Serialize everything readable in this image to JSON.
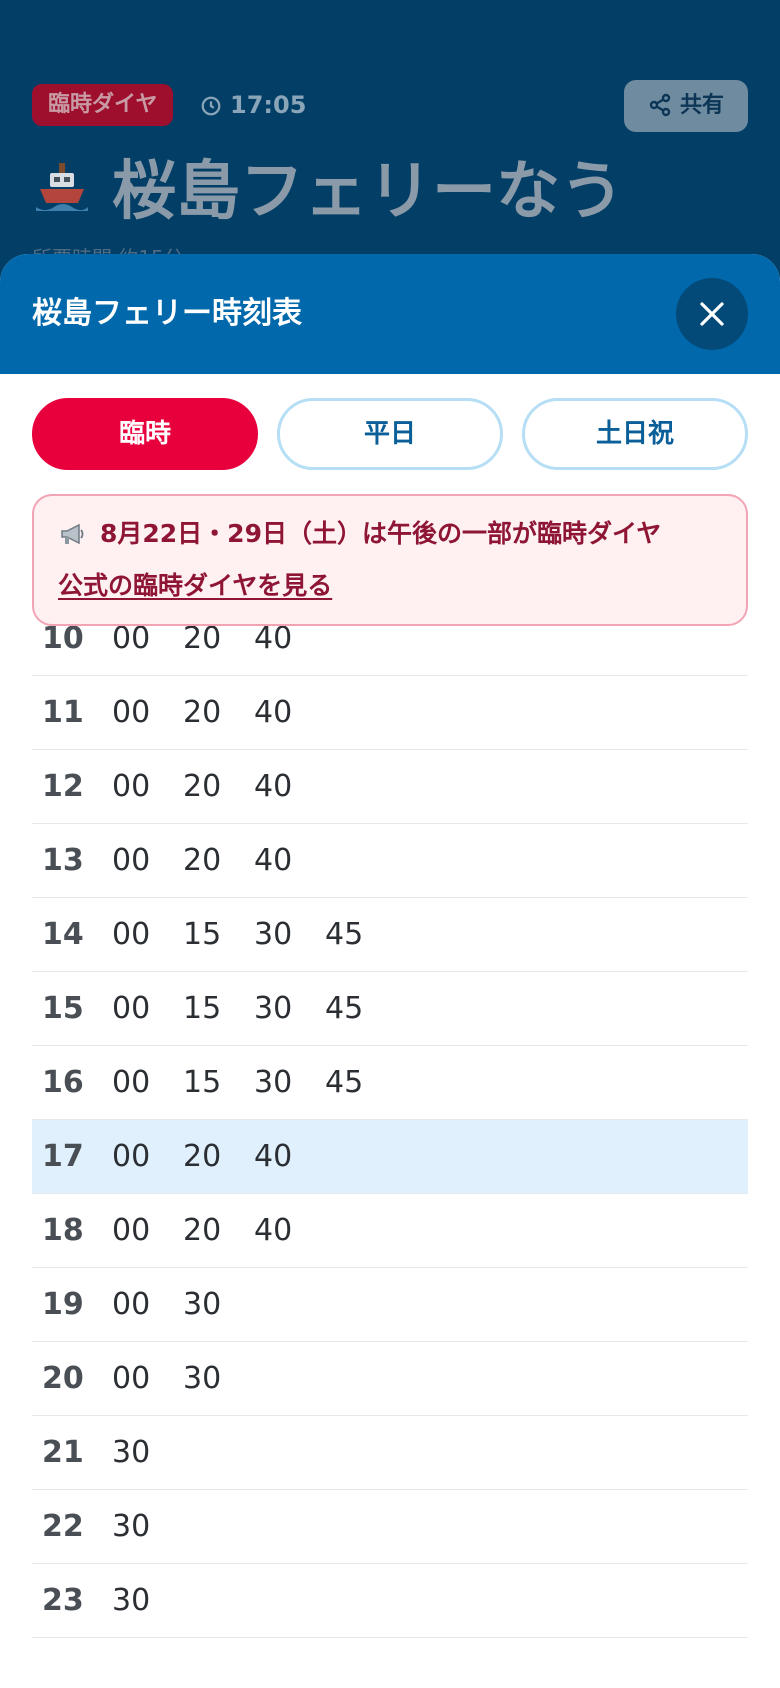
{
  "background": {
    "badge": "臨時ダイヤ",
    "time": "17:05",
    "share_label": "共有",
    "title": "桜島フェリーなう",
    "subtitle": "所要時間 約15分"
  },
  "sheet": {
    "title": "桜島フェリー時刻表",
    "tabs": [
      {
        "label": "臨時",
        "active": true
      },
      {
        "label": "平日",
        "active": false
      },
      {
        "label": "土日祝",
        "active": false
      }
    ],
    "notice": {
      "text": "8月22日・29日（土）は午後の一部が臨時ダイヤ",
      "link": "公式の臨時ダイヤを見る"
    },
    "timetable": [
      {
        "hour": "10",
        "minutes": [
          "00",
          "20",
          "40"
        ]
      },
      {
        "hour": "11",
        "minutes": [
          "00",
          "20",
          "40"
        ]
      },
      {
        "hour": "12",
        "minutes": [
          "00",
          "20",
          "40"
        ]
      },
      {
        "hour": "13",
        "minutes": [
          "00",
          "20",
          "40"
        ]
      },
      {
        "hour": "14",
        "minutes": [
          "00",
          "15",
          "30",
          "45"
        ]
      },
      {
        "hour": "15",
        "minutes": [
          "00",
          "15",
          "30",
          "45"
        ]
      },
      {
        "hour": "16",
        "minutes": [
          "00",
          "15",
          "30",
          "45"
        ]
      },
      {
        "hour": "17",
        "minutes": [
          "00",
          "20",
          "40"
        ],
        "current": true
      },
      {
        "hour": "18",
        "minutes": [
          "00",
          "20",
          "40"
        ]
      },
      {
        "hour": "19",
        "minutes": [
          "00",
          "30"
        ]
      },
      {
        "hour": "20",
        "minutes": [
          "00",
          "30"
        ]
      },
      {
        "hour": "21",
        "minutes": [
          "30"
        ]
      },
      {
        "hour": "22",
        "minutes": [
          "30"
        ]
      },
      {
        "hour": "23",
        "minutes": [
          "30"
        ]
      }
    ]
  },
  "colors": {
    "header": "#0068ab",
    "active_tab": "#e8003d",
    "notice_text": "#8e1534",
    "current_row": "#e0f1fd"
  }
}
